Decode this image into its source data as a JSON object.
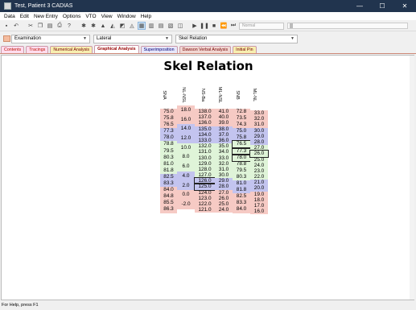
{
  "window": {
    "title": "Test, Patient 3 CADIAS",
    "min": "—",
    "max": "☐",
    "close": "✕"
  },
  "menu": [
    "Data",
    "Edit",
    "New Entry",
    "Options",
    "VTO",
    "View",
    "Window",
    "Help"
  ],
  "toolbar": {
    "select_value": "Normal"
  },
  "filters": {
    "examination": "Examination",
    "view": "Lateral",
    "analysis": "Skel Relation"
  },
  "tabs": [
    "Contents",
    "Tracings",
    "Numerical Analysis",
    "Graphical Analysis",
    "Superimposition",
    "Dawson Verbal Analysis",
    "Initial Pin"
  ],
  "chart": {
    "title": "Skel Relation",
    "columns": [
      "SNA",
      "NL-NSL",
      "NS-Ba",
      "ML-NSL",
      "SNB",
      "ML-NL"
    ],
    "values": {
      "sna": [
        "75.0",
        "75.8",
        "76.5",
        "77.3",
        "78.0",
        "78.8",
        "79.5",
        "80.3",
        "81.0",
        "81.8",
        "82.5",
        "83.3",
        "84.0",
        "84.8",
        "85.5",
        "86.3"
      ],
      "nlnsl": [
        "18.0",
        "16.0",
        "14.0",
        "12.0",
        "10.0",
        "8.0",
        "6.0",
        "4.0",
        "2.0",
        "0.0",
        "-2.0"
      ],
      "nsba": [
        "138.0",
        "137.0",
        "136.0",
        "135.0",
        "134.0",
        "133.0",
        "132.0",
        "131.0",
        "130.0",
        "129.0",
        "128.0",
        "127.0",
        "126.0",
        "125.0",
        "124.0",
        "123.0",
        "122.0",
        "121.0"
      ],
      "mlnsl": [
        "41.0",
        "40.0",
        "39.0",
        "38.0",
        "37.0",
        "36.0",
        "35.0",
        "34.0",
        "33.0",
        "32.0",
        "31.0",
        "30.0",
        "29.0",
        "28.0",
        "27.0",
        "26.0",
        "25.0",
        "24.0"
      ],
      "snb": [
        "72.8",
        "73.5",
        "74.3",
        "75.0",
        "75.8",
        "76.5",
        "77.3",
        "78.0",
        "78.8",
        "79.5",
        "80.3",
        "81.0",
        "81.8",
        "82.5",
        "83.3",
        "84.0"
      ],
      "mlnl": [
        "33.0",
        "32.0",
        "31.0",
        "30.0",
        "29.0",
        "28.0",
        "27.0",
        "26.0",
        "25.0",
        "24.0",
        "23.0",
        "22.0",
        "21.0",
        "20.0",
        "19.0",
        "18.0",
        "17.0",
        "16.0"
      ]
    }
  },
  "status": "For Help, press F1"
}
